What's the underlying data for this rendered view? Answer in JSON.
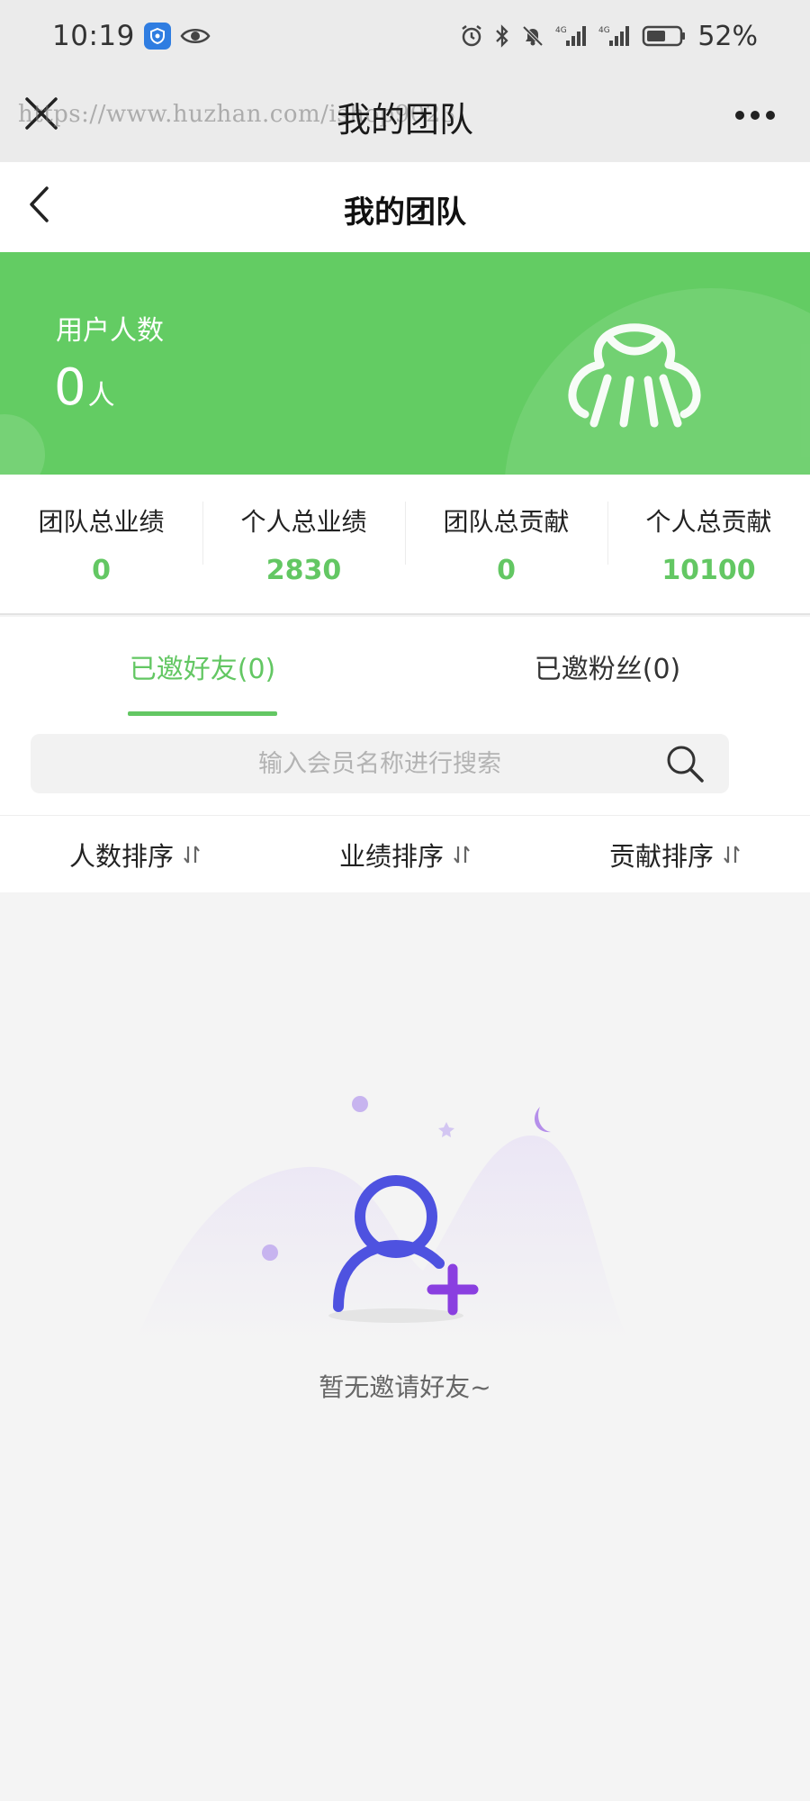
{
  "status_bar": {
    "time": "10:19",
    "battery_percent": "52%",
    "icons": [
      "shield-badge-icon",
      "eye-icon",
      "alarm-icon",
      "bluetooth-icon",
      "mute-icon",
      "signal-4g-icon",
      "signal-4g-icon",
      "battery-icon"
    ]
  },
  "wechat_bar": {
    "title": "我的团队",
    "watermark": "https://www.huzhan.com/ishop9023",
    "close_icon": "close-icon",
    "more_icon": "more-icon"
  },
  "header": {
    "title": "我的团队",
    "back_icon": "chevron-left-icon"
  },
  "banner": {
    "label": "用户人数",
    "count": "0",
    "unit": "人",
    "color": "#63cc63"
  },
  "stats": [
    {
      "label": "团队总业绩",
      "value": "0"
    },
    {
      "label": "个人总业绩",
      "value": "2830"
    },
    {
      "label": "团队总贡献",
      "value": "0"
    },
    {
      "label": "个人总贡献",
      "value": "10100"
    }
  ],
  "tabs": [
    {
      "label": "已邀好友(0)",
      "active": true
    },
    {
      "label": "已邀粉丝(0)",
      "active": false
    }
  ],
  "search": {
    "placeholder": "输入会员名称进行搜索",
    "value": ""
  },
  "sort": [
    {
      "label": "人数排序"
    },
    {
      "label": "业绩排序"
    },
    {
      "label": "贡献排序"
    }
  ],
  "empty_state": {
    "text": "暂无邀请好友~"
  },
  "colors": {
    "accent": "#63c763",
    "illustration": "#6a4fe6"
  }
}
